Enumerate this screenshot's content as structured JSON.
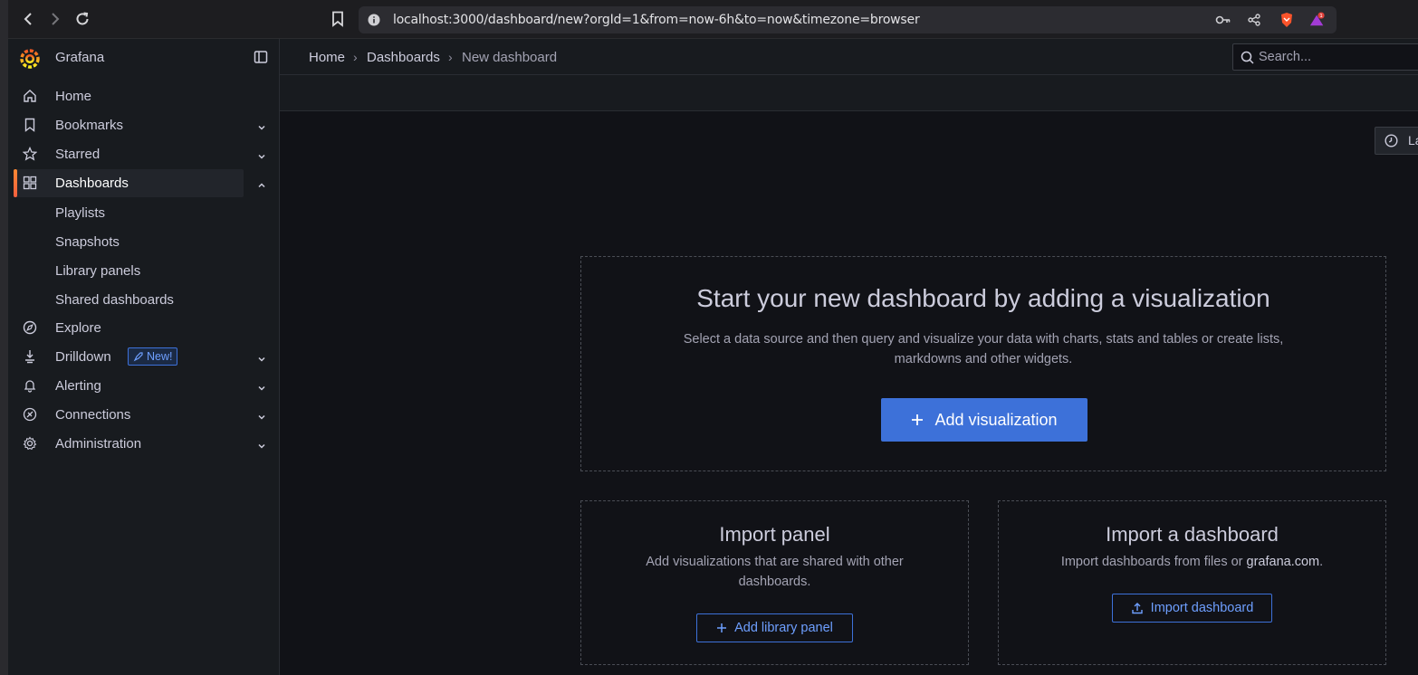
{
  "browser": {
    "url": "localhost:3000/dashboard/new?orgId=1&from=now-6h&to=now&timezone=browser",
    "notification_count": "1"
  },
  "sidebar": {
    "brand": "Grafana",
    "items": [
      {
        "label": "Home",
        "icon": "home-icon"
      },
      {
        "label": "Bookmarks",
        "icon": "bookmark-icon"
      },
      {
        "label": "Starred",
        "icon": "star-icon"
      },
      {
        "label": "Dashboards",
        "icon": "apps-icon"
      },
      {
        "label": "Explore",
        "icon": "compass-icon"
      },
      {
        "label": "Drilldown",
        "icon": "drilldown-icon",
        "badge": "New!"
      },
      {
        "label": "Alerting",
        "icon": "bell-icon"
      },
      {
        "label": "Connections",
        "icon": "plug-icon"
      },
      {
        "label": "Administration",
        "icon": "cog-icon"
      }
    ],
    "dashboard_children": [
      "Playlists",
      "Snapshots",
      "Library panels",
      "Shared dashboards"
    ]
  },
  "breadcrumb": [
    "Home",
    "Dashboards",
    "New dashboard"
  ],
  "search": {
    "placeholder": "Search..."
  },
  "time_picker": {
    "label": "La"
  },
  "empty_state": {
    "title": "Start your new dashboard by adding a visualization",
    "text_line1": "Select a data source and then query and visualize your data with charts, stats and tables or create lists,",
    "text_line2": "markdowns and other widgets.",
    "button": "Add visualization"
  },
  "import_panel": {
    "title": "Import panel",
    "text_line1": "Add visualizations that are shared with other",
    "text_line2": "dashboards.",
    "button": "Add library panel"
  },
  "import_dashboard": {
    "title": "Import a dashboard",
    "text_prefix": "Import dashboards from files or ",
    "text_link": "grafana.com",
    "text_suffix": ".",
    "button": "Import dashboard"
  },
  "colors": {
    "accent": "#3d71d9",
    "active_bar": "#ff8833",
    "background": "#111217",
    "panel": "#181b1f"
  }
}
